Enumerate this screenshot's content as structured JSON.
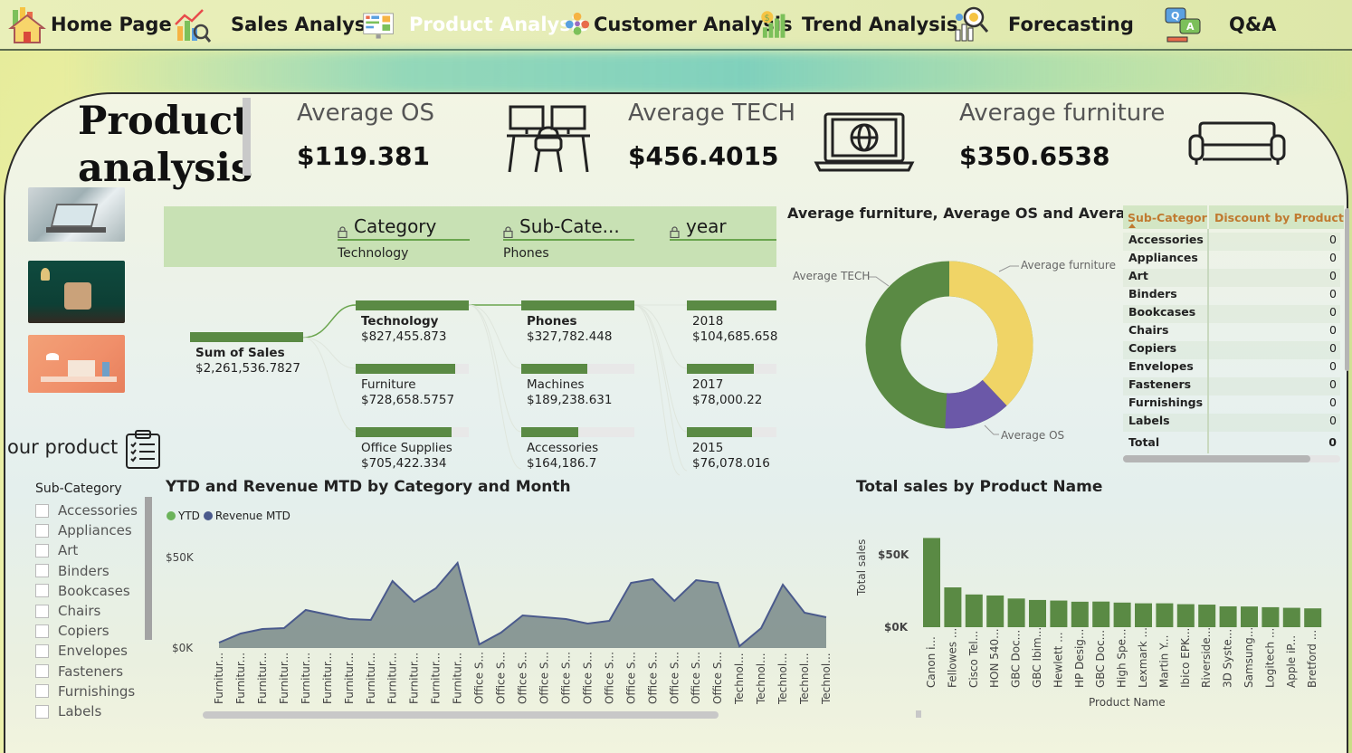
{
  "nav": {
    "items": [
      {
        "label": "Home Page",
        "icon": "home-icon",
        "active": false
      },
      {
        "label": "Sales Analysis",
        "icon": "sales-chart-icon",
        "active": false
      },
      {
        "label": "Product Analysis",
        "icon": "dashboard-icon",
        "active": true
      },
      {
        "label": "Customer Analysis",
        "icon": "customers-icon",
        "active": false
      },
      {
        "label": "Trend Analysis",
        "icon": "trend-icon",
        "active": false
      },
      {
        "label": "Forecasting",
        "icon": "forecast-icon",
        "active": false
      },
      {
        "label": "Q&A",
        "icon": "qa-icon",
        "active": false
      }
    ]
  },
  "page_title": "Product analysis",
  "kpis": [
    {
      "label": "Average OS",
      "value": "$119.381",
      "icon": "office-desk-icon"
    },
    {
      "label": "Average TECH",
      "value": "$456.4015",
      "icon": "laptop-globe-icon"
    },
    {
      "label": "Average furniture",
      "value": "$350.6538",
      "icon": "sofa-icon"
    }
  ],
  "thumbnails": [
    "laptop-photo",
    "armchair-photo",
    "desk-lamp-photo"
  ],
  "our_product": {
    "label": "our product",
    "icon": "clipboard-list-icon"
  },
  "decomposition": {
    "fields": [
      {
        "title": "Category",
        "value": "Technology"
      },
      {
        "title": "Sub-Cate...",
        "value": "Phones"
      },
      {
        "title": "year",
        "value": ""
      }
    ],
    "root": {
      "label": "Sum of Sales",
      "value": "$2,261,536.7827"
    },
    "level1": [
      {
        "label": "Technology",
        "value": "$827,455.873",
        "bold": true,
        "fill": 1.0
      },
      {
        "label": "Furniture",
        "value": "$728,658.5757",
        "bold": false,
        "fill": 0.88
      },
      {
        "label": "Office Supplies",
        "value": "$705,422.334",
        "bold": false,
        "fill": 0.85
      }
    ],
    "level2": [
      {
        "label": "Phones",
        "value": "$327,782.448",
        "bold": true,
        "fill": 1.0
      },
      {
        "label": "Machines",
        "value": "$189,238.631",
        "bold": false,
        "fill": 0.58
      },
      {
        "label": "Accessories",
        "value": "$164,186.7",
        "bold": false,
        "fill": 0.5
      }
    ],
    "level3": [
      {
        "label": "2018",
        "value": "$104,685.658",
        "bold": false,
        "fill": 1.0
      },
      {
        "label": "2017",
        "value": "$78,000.22",
        "bold": false,
        "fill": 0.75
      },
      {
        "label": "2015",
        "value": "$76,078.016",
        "bold": false,
        "fill": 0.73
      }
    ]
  },
  "donut": {
    "title": "Average furniture, Average OS and Averag...",
    "labels": {
      "tech": "Average TECH",
      "furniture": "Average furniture",
      "os": "Average OS"
    },
    "colors": {
      "tech": "#5a8a44",
      "furniture": "#f0d466",
      "os": "#6b58a8"
    }
  },
  "table": {
    "headers": [
      "Sub-Category",
      "Discount by Product Count"
    ],
    "rows": [
      {
        "name": "Accessories",
        "value": "0"
      },
      {
        "name": "Appliances",
        "value": "0"
      },
      {
        "name": "Art",
        "value": "0"
      },
      {
        "name": "Binders",
        "value": "0"
      },
      {
        "name": "Bookcases",
        "value": "0"
      },
      {
        "name": "Chairs",
        "value": "0"
      },
      {
        "name": "Copiers",
        "value": "0"
      },
      {
        "name": "Envelopes",
        "value": "0"
      },
      {
        "name": "Fasteners",
        "value": "0"
      },
      {
        "name": "Furnishings",
        "value": "0"
      },
      {
        "name": "Labels",
        "value": "0"
      }
    ],
    "total": {
      "name": "Total",
      "value": "0"
    }
  },
  "slicer": {
    "title": "Sub-Category",
    "items": [
      "Accessories",
      "Appliances",
      "Art",
      "Binders",
      "Bookcases",
      "Chairs",
      "Copiers",
      "Envelopes",
      "Fasteners",
      "Furnishings",
      "Labels"
    ]
  },
  "chart_data": [
    {
      "type": "area",
      "title": "YTD and Revenue MTD by Category and Month",
      "legend": [
        {
          "name": "YTD",
          "color": "#6bb35a"
        },
        {
          "name": "Revenue MTD",
          "color": "#4a5a8c"
        }
      ],
      "ylabel": "",
      "yticks": [
        "$50K",
        "$0K"
      ],
      "ylim": [
        0,
        60000
      ],
      "categories": [
        "Furnitur...",
        "Furnitur...",
        "Furnitur...",
        "Furnitur...",
        "Furnitur...",
        "Furnitur...",
        "Furnitur...",
        "Furnitur...",
        "Furnitur...",
        "Furnitur...",
        "Furnitur...",
        "Furnitur...",
        "Office S...",
        "Office S...",
        "Office S...",
        "Office S...",
        "Office S...",
        "Office S...",
        "Office S...",
        "Office S...",
        "Office S...",
        "Office S...",
        "Office S...",
        "Office S...",
        "Technol...",
        "Technol...",
        "Technol...",
        "Technol...",
        "Technol..."
      ],
      "series": [
        {
          "name": "Revenue MTD",
          "values": [
            3000,
            8000,
            10500,
            11000,
            21000,
            18500,
            16000,
            15500,
            37000,
            25500,
            33000,
            47000,
            2000,
            8500,
            18000,
            17000,
            16000,
            13500,
            15000,
            36000,
            38000,
            26000,
            37500,
            36000,
            1000,
            11000,
            35000,
            19500,
            17000
          ]
        }
      ]
    },
    {
      "type": "bar",
      "title": "Total sales by Product Name",
      "xlabel": "Product Name",
      "ylabel": "Total sales",
      "yticks": [
        "$50K",
        "$0K"
      ],
      "ylim": [
        0,
        70000
      ],
      "categories": [
        "Canon i...",
        "Fellowes ...",
        "Cisco Tel...",
        "HON 540...",
        "GBC Doc...",
        "GBC Ibim...",
        "Hewlett ...",
        "HP Desig...",
        "GBC Doc...",
        "High Spe...",
        "Lexmark ...",
        "Martin Y...",
        "Ibico EPK...",
        "Riverside...",
        "3D Syste...",
        "Samsung...",
        "Logitech ...",
        "Apple iP...",
        "Bretford ..."
      ],
      "values": [
        61600,
        27500,
        22600,
        21900,
        19800,
        18800,
        18400,
        17600,
        17700,
        17000,
        16500,
        16500,
        15900,
        15600,
        14400,
        14300,
        13800,
        13400,
        13000
      ]
    }
  ]
}
